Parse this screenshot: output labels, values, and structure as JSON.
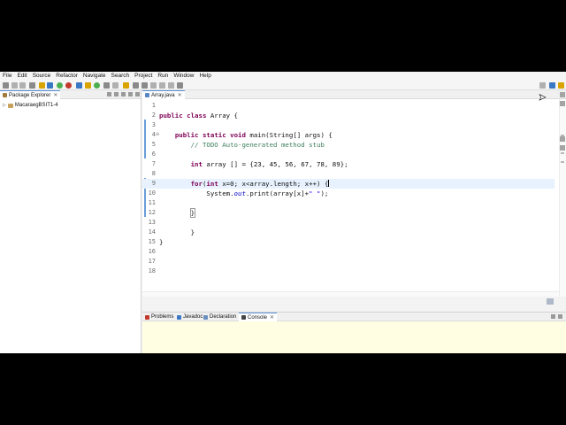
{
  "menu": [
    "File",
    "Edit",
    "Source",
    "Refactor",
    "Navigate",
    "Search",
    "Project",
    "Run",
    "Window",
    "Help"
  ],
  "package_explorer": {
    "tab_label": "Package Explorer",
    "project_name": "MacaraegBSIT1-4"
  },
  "editor": {
    "tab_label": "Array.java",
    "lines": [
      {
        "n": "1",
        "text": ""
      },
      {
        "n": "2",
        "text": "public class Array {"
      },
      {
        "n": "3",
        "text": ""
      },
      {
        "n": "4",
        "text": "    public static void main(String[] args) {"
      },
      {
        "n": "5",
        "text": "        // TODO Auto-generated method stub"
      },
      {
        "n": "6",
        "text": ""
      },
      {
        "n": "7",
        "text": "        int array [] = {23, 45, 56, 67, 78, 89};"
      },
      {
        "n": "8",
        "text": ""
      },
      {
        "n": "9",
        "text": "        for(int x=0; x<array.length; x++) {"
      },
      {
        "n": "10",
        "text": "            System.out.print(array[x]+\" \");"
      },
      {
        "n": "11",
        "text": ""
      },
      {
        "n": "12",
        "text": "        }"
      },
      {
        "n": "13",
        "text": ""
      },
      {
        "n": "14",
        "text": "        }"
      },
      {
        "n": "15",
        "text": "}"
      },
      {
        "n": "16",
        "text": ""
      },
      {
        "n": "17",
        "text": ""
      },
      {
        "n": "18",
        "text": ""
      }
    ],
    "current_line": "9"
  },
  "bottom_views": {
    "tabs": [
      "Problems",
      "Javadoc",
      "Declaration",
      "Console"
    ],
    "active_tab": "Console"
  },
  "colors": {
    "keyword": "#7f0055",
    "comment": "#3f7f5f",
    "string": "#2a00ff",
    "field": "#0000c0",
    "current_line_bg": "#e8f2fe",
    "console_bg": "#fffde2"
  },
  "icons": [
    "package-explorer-icon",
    "project-icon",
    "java-file-icon",
    "problems-icon",
    "javadoc-icon",
    "declaration-icon",
    "console-icon",
    "minimize-icon",
    "maximize-icon",
    "search-icon"
  ]
}
